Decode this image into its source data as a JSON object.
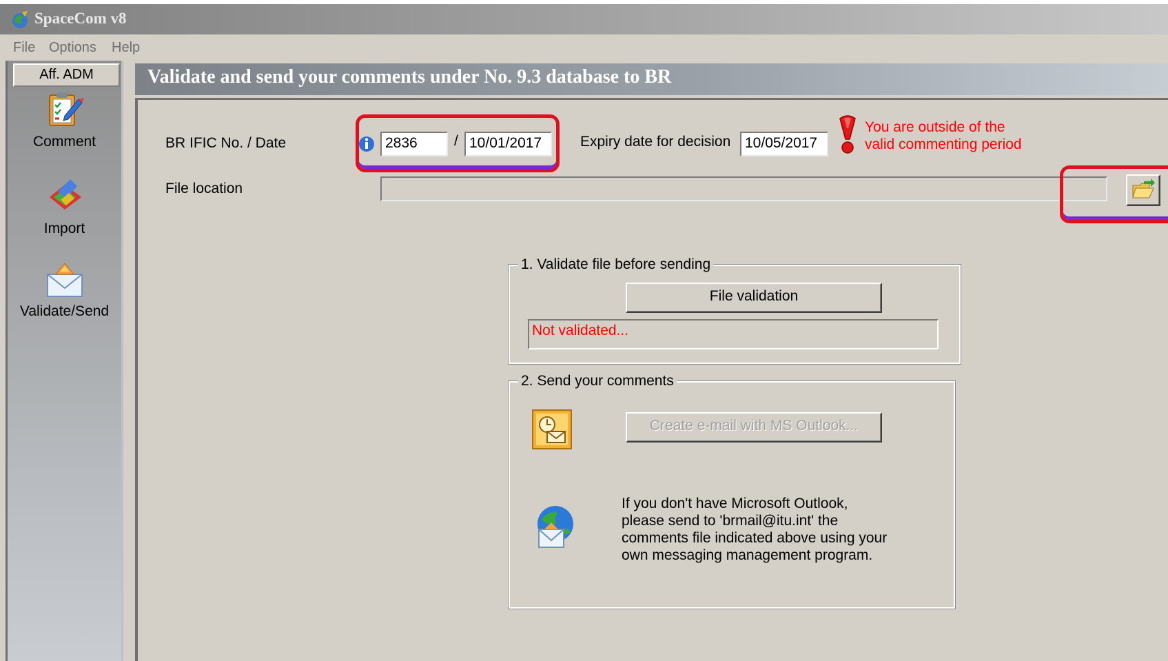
{
  "window": {
    "title": "SpaceCom v8"
  },
  "menu": {
    "items": [
      "File",
      "Options",
      "Help"
    ]
  },
  "sidebar": {
    "header": "Aff. ADM",
    "items": [
      {
        "label": "Comment",
        "icon": "comment-clipboard-icon"
      },
      {
        "label": "Import",
        "icon": "import-icon"
      },
      {
        "label": "Validate/Send",
        "icon": "validate-send-envelope-icon"
      }
    ]
  },
  "main": {
    "title": "Validate and send your comments under No. 9.3 database to BR",
    "ific_label": "BR IFIC No. / Date",
    "ific_no": "2836",
    "separator": "/",
    "ific_date": "10/01/2017",
    "expiry_label": "Expiry date for decision",
    "expiry_date": "10/05/2017",
    "warning_line1": "You are outside of the",
    "warning_line2": "valid commenting period",
    "file_location_label": "File location",
    "file_location_value": ""
  },
  "validate_group": {
    "legend": "1. Validate file before sending",
    "button": "File validation",
    "status": "Not validated..."
  },
  "send_group": {
    "legend": "2. Send your comments",
    "outlook_button": "Create e-mail with MS Outlook...",
    "info_lines": [
      "If you don't have Microsoft Outlook,",
      "please send to 'brmail@itu.int' the",
      "comments file indicated above using your",
      "own messaging management program."
    ]
  },
  "colors": {
    "warning": "#ff0000",
    "highlight_red": "#e01020",
    "highlight_purple": "#7a2ad0"
  }
}
